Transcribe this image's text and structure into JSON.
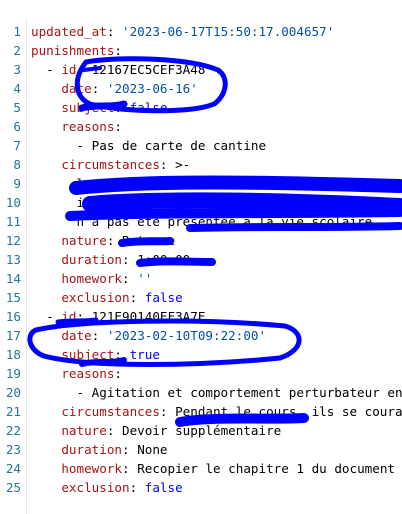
{
  "editor": {
    "lines": [
      {
        "num": "1",
        "indent": "",
        "key": "updated_at",
        "sep": ": ",
        "value": "'2023-06-17T15:50:17.004657'",
        "vtype": "s"
      },
      {
        "num": "2",
        "indent": "",
        "key": "punishments",
        "sep": ":",
        "value": "",
        "vtype": "t"
      },
      {
        "num": "3",
        "indent": "  - ",
        "key": "id",
        "sep": ": ",
        "value": "12167EC5CEF3A48",
        "vtype": "t"
      },
      {
        "num": "4",
        "indent": "    ",
        "key": "date",
        "sep": ": ",
        "value": "'2023-06-16'",
        "vtype": "s"
      },
      {
        "num": "5",
        "indent": "    ",
        "key": "subject",
        "sep": ": ",
        "value": "false",
        "vtype": "c"
      },
      {
        "num": "6",
        "indent": "    ",
        "key": "reasons",
        "sep": ":",
        "value": "",
        "vtype": "t"
      },
      {
        "num": "7",
        "indent": "      ",
        "key": "",
        "sep": "",
        "value": "- Pas de carte de cantine",
        "vtype": "t"
      },
      {
        "num": "8",
        "indent": "    ",
        "key": "circumstances",
        "sep": ": ",
        "value": ">-",
        "vtype": "t"
      },
      {
        "num": "9",
        "indent": "      ",
        "key": "",
        "sep": "",
        "value": "lors des interventions de la vie scolaire",
        "vtype": "t"
      },
      {
        "num": "10",
        "indent": "      ",
        "key": "",
        "sep": "",
        "value": "il n'a pas présenté sa carte de cantine",
        "vtype": "t"
      },
      {
        "num": "11",
        "indent": "      ",
        "key": "",
        "sep": "",
        "value": "n'a pas été présentée à la vie scolaire",
        "vtype": "t"
      },
      {
        "num": "12",
        "indent": "    ",
        "key": "nature",
        "sep": ": ",
        "value": "Retenue",
        "vtype": "t"
      },
      {
        "num": "13",
        "indent": "    ",
        "key": "duration",
        "sep": ": ",
        "value": "1:00:00",
        "vtype": "t"
      },
      {
        "num": "14",
        "indent": "    ",
        "key": "homework",
        "sep": ": ",
        "value": "''",
        "vtype": "s"
      },
      {
        "num": "15",
        "indent": "    ",
        "key": "exclusion",
        "sep": ": ",
        "value": "false",
        "vtype": "c"
      },
      {
        "num": "16",
        "indent": "  - ",
        "key": "id",
        "sep": ": ",
        "value": "121E90140EF3A7E",
        "vtype": "t"
      },
      {
        "num": "17",
        "indent": "    ",
        "key": "date",
        "sep": ": ",
        "value": "'2023-02-10T09:22:00'",
        "vtype": "s"
      },
      {
        "num": "18",
        "indent": "    ",
        "key": "subject",
        "sep": ": ",
        "value": "true",
        "vtype": "c"
      },
      {
        "num": "19",
        "indent": "    ",
        "key": "reasons",
        "sep": ":",
        "value": "",
        "vtype": "t"
      },
      {
        "num": "20",
        "indent": "      ",
        "key": "",
        "sep": "",
        "value": "- Agitation et comportement perturbateur en cours",
        "vtype": "t"
      },
      {
        "num": "21",
        "indent": "    ",
        "key": "circumstances",
        "sep": ": ",
        "value": "Pendant le cours, ils se couraient après",
        "vtype": "t"
      },
      {
        "num": "22",
        "indent": "    ",
        "key": "nature",
        "sep": ": ",
        "value": "Devoir supplémentaire",
        "vtype": "t"
      },
      {
        "num": "23",
        "indent": "    ",
        "key": "duration",
        "sep": ": ",
        "value": "None",
        "vtype": "t"
      },
      {
        "num": "24",
        "indent": "    ",
        "key": "homework",
        "sep": ": ",
        "value": "Recopier le chapitre 1 du document",
        "vtype": "t"
      },
      {
        "num": "25",
        "indent": "    ",
        "key": "exclusion",
        "sep": ": ",
        "value": "false",
        "vtype": "c"
      }
    ]
  },
  "colors": {
    "line_number": "#237893",
    "key": "#a31515",
    "string": "#0451a5",
    "constant": "#0000ff",
    "annotation_ink": "#0000ff"
  }
}
